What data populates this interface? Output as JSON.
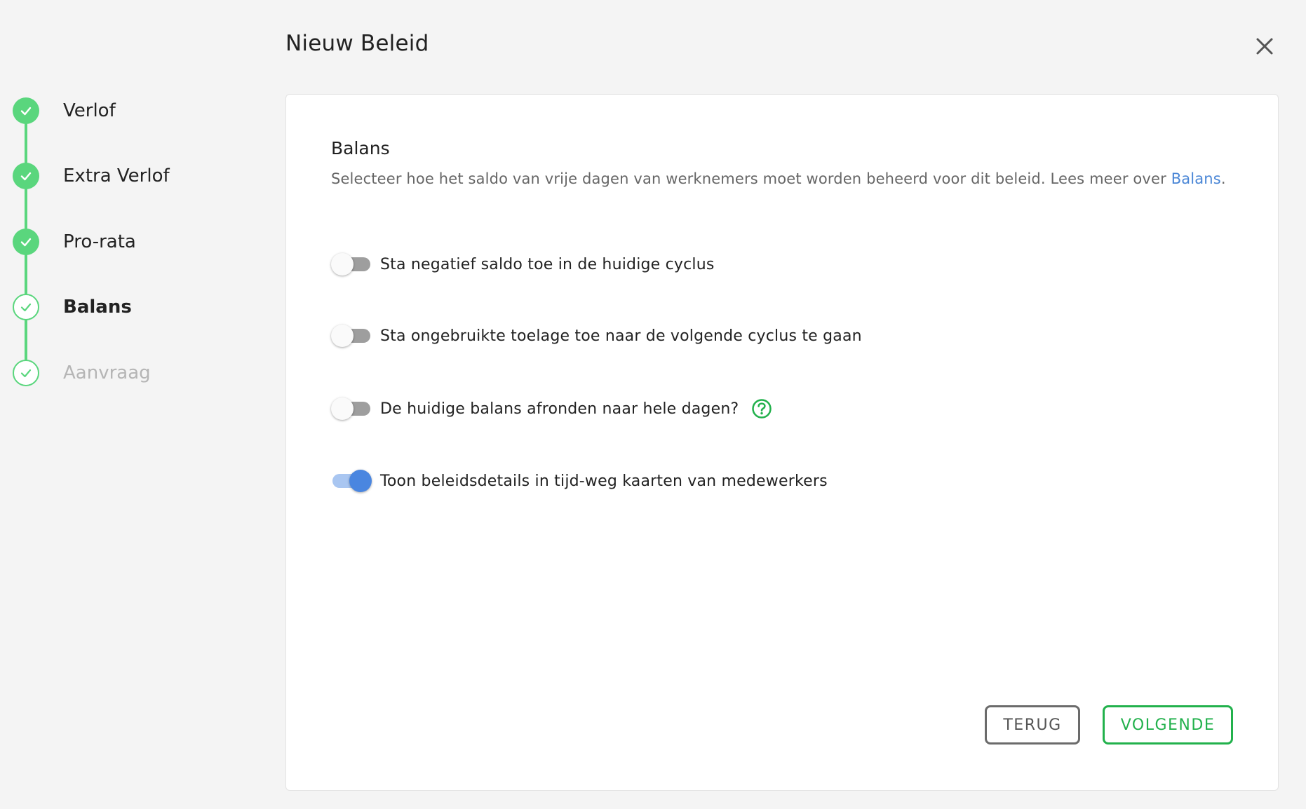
{
  "header": {
    "title": "Nieuw Beleid",
    "close_icon": "close-icon"
  },
  "stepper": {
    "steps": [
      {
        "label": "Verlof",
        "state": "completed"
      },
      {
        "label": "Extra Verlof",
        "state": "completed"
      },
      {
        "label": "Pro-rata",
        "state": "completed"
      },
      {
        "label": "Balans",
        "state": "current"
      },
      {
        "label": "Aanvraag",
        "state": "upcoming"
      }
    ]
  },
  "section": {
    "title": "Balans",
    "description_prefix": "Selecteer hoe het saldo van vrije dagen van werknemers moet worden beheerd voor dit beleid. Lees meer over ",
    "description_link": "Balans",
    "description_suffix": "."
  },
  "toggles": [
    {
      "label": "Sta negatief saldo toe in de huidige cyclus",
      "checked": false
    },
    {
      "label": "Sta ongebruikte toelage toe naar de volgende cyclus te gaan",
      "checked": false
    },
    {
      "label": "De huidige balans afronden naar hele dagen?",
      "checked": false,
      "help_icon": "help-circle-icon"
    },
    {
      "label": "Toon beleidsdetails in tijd-weg kaarten van medewerkers",
      "checked": true
    }
  ],
  "footer": {
    "back_label": "TERUG",
    "next_label": "VOLGENDE"
  },
  "colors": {
    "accent_green": "#5ad67d",
    "button_green": "#22b14c",
    "link_blue": "#4a86d6",
    "toggle_on": "#4a86e0"
  }
}
